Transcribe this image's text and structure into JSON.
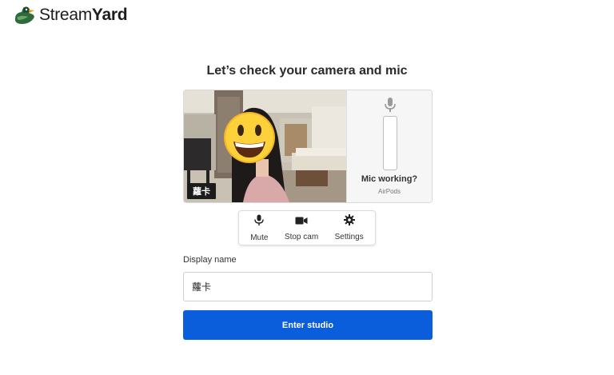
{
  "brand": {
    "name_part1": "Stream",
    "name_part2": "Yard",
    "logo_icon": "duck-icon"
  },
  "main": {
    "heading": "Let’s check your camera and mic"
  },
  "preview": {
    "name_tag": "蘿卡",
    "face_overlay": "grinning-emoji",
    "mic": {
      "icon": "microphone-icon",
      "status": "Mic working?",
      "device": "AirPods"
    }
  },
  "controls": [
    {
      "label": "Mute",
      "icon": "microphone-icon"
    },
    {
      "label": "Stop cam",
      "icon": "video-camera-icon"
    },
    {
      "label": "Settings",
      "icon": "gear-icon"
    }
  ],
  "form": {
    "display_name_label": "Display name",
    "display_name_value": "蘿卡",
    "submit_label": "Enter studio"
  },
  "colors": {
    "primary": "#0a5ddb",
    "text": "#222222"
  }
}
